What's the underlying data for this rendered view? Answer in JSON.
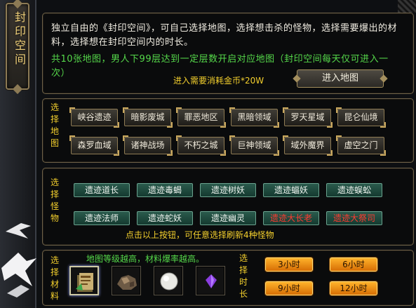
{
  "title": "封印空间",
  "intro": {
    "description": "独立自由的《封印空间》，可自己选择地图，选择想击杀的怪物，选择需要爆出的材料，选择想在封印空间内的时长。",
    "green_note": "共10张地图，男人下99层达到一定层数开启对应地图（封印空间每天仅可进入一次）",
    "cost": "进入需要消耗金币*20W",
    "enter_button": "进入地图"
  },
  "maps": {
    "label": "选择地图",
    "items": [
      "峡谷遗迹",
      "暗影废城",
      "罪恶地区",
      "黑暗领域",
      "罗天星域",
      "昆仑仙境",
      "森罗血域",
      "诸神战场",
      "不朽之城",
      "巨神领域",
      "域外魔界",
      "虚空之门"
    ]
  },
  "monsters": {
    "label": "选择怪物",
    "items": [
      {
        "label": "遗迹道长",
        "color": "#eef4ef"
      },
      {
        "label": "遗迹毒蝎",
        "color": "#eef4ef"
      },
      {
        "label": "遗迹树妖",
        "color": "#eef4ef"
      },
      {
        "label": "遗迹蝠妖",
        "color": "#eef4ef"
      },
      {
        "label": "遗迹蜈蚣",
        "color": "#eef4ef"
      },
      {
        "label": "遗迹法师",
        "color": "#eef4ef"
      },
      {
        "label": "遗迹蛇妖",
        "color": "#eef4ef"
      },
      {
        "label": "遗迹幽灵",
        "color": "#eef4ef"
      },
      {
        "label": "遗迹大长老",
        "color": "#ff3b30"
      },
      {
        "label": "遗迹大祭司",
        "color": "#ff3b30"
      }
    ],
    "hint": "点击以上按钮，可任意选择刷新4种怪物"
  },
  "materials": {
    "label": "选择材料",
    "hint": "地图等级越高，材料爆率越高。",
    "slots": [
      {
        "icon": "scroll-book-icon",
        "selected": true
      },
      {
        "icon": "ore-rock-icon",
        "selected": false
      },
      {
        "icon": "pearl-icon",
        "selected": false
      },
      {
        "icon": "purple-gem-icon",
        "selected": false
      }
    ]
  },
  "time": {
    "label": "选择时长",
    "options": [
      "3小时",
      "6小时",
      "9小时",
      "12小时"
    ]
  },
  "colors": {
    "accent_gold": "#f3cf2d",
    "accent_green": "#55d84a",
    "warning_red": "#ff3b30",
    "frame_bronze": "#8f7c54"
  }
}
